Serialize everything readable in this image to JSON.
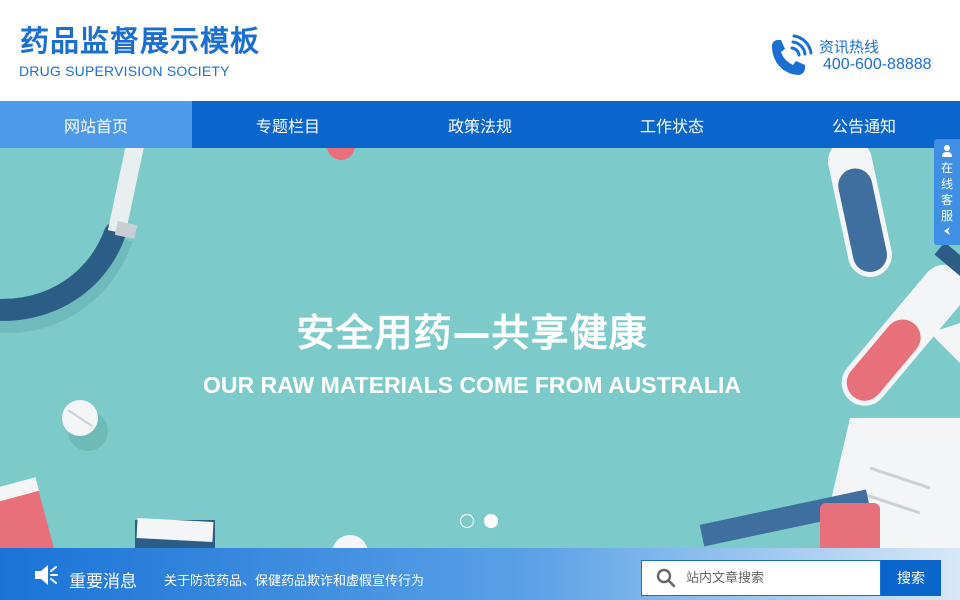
{
  "header": {
    "logo_cn": "药品监督展示模板",
    "logo_en": "DRUG SUPERVISION SOCIETY",
    "hotline_label": "资讯热线",
    "hotline_number": "400-600-88888"
  },
  "nav": {
    "items": [
      {
        "label": "网站首页",
        "active": true
      },
      {
        "label": "专题栏目",
        "active": false
      },
      {
        "label": "政策法规",
        "active": false
      },
      {
        "label": "工作状态",
        "active": false
      },
      {
        "label": "公告通知",
        "active": false
      }
    ]
  },
  "banner": {
    "title": "安全用药—共享健康",
    "subtitle": "OUR RAW MATERIALS COME FROM AUSTRALIA",
    "slides_total": 2,
    "active_slide": 2
  },
  "service_tab": {
    "label": "在线客服"
  },
  "newsbar": {
    "title": "重要消息",
    "text": "关于防范药品、保健药品欺诈和虚假宣传行为"
  },
  "search": {
    "placeholder": "站内文章搜索",
    "value": "",
    "button_label": "搜索"
  },
  "colors": {
    "brand_blue": "#0a66cc",
    "nav_active": "#4d9ae8",
    "banner_bg": "#7ccbca"
  },
  "icons": {
    "hotline": "phone-icon",
    "speaker": "speaker-icon",
    "search": "search-icon",
    "service": "person-icon"
  }
}
